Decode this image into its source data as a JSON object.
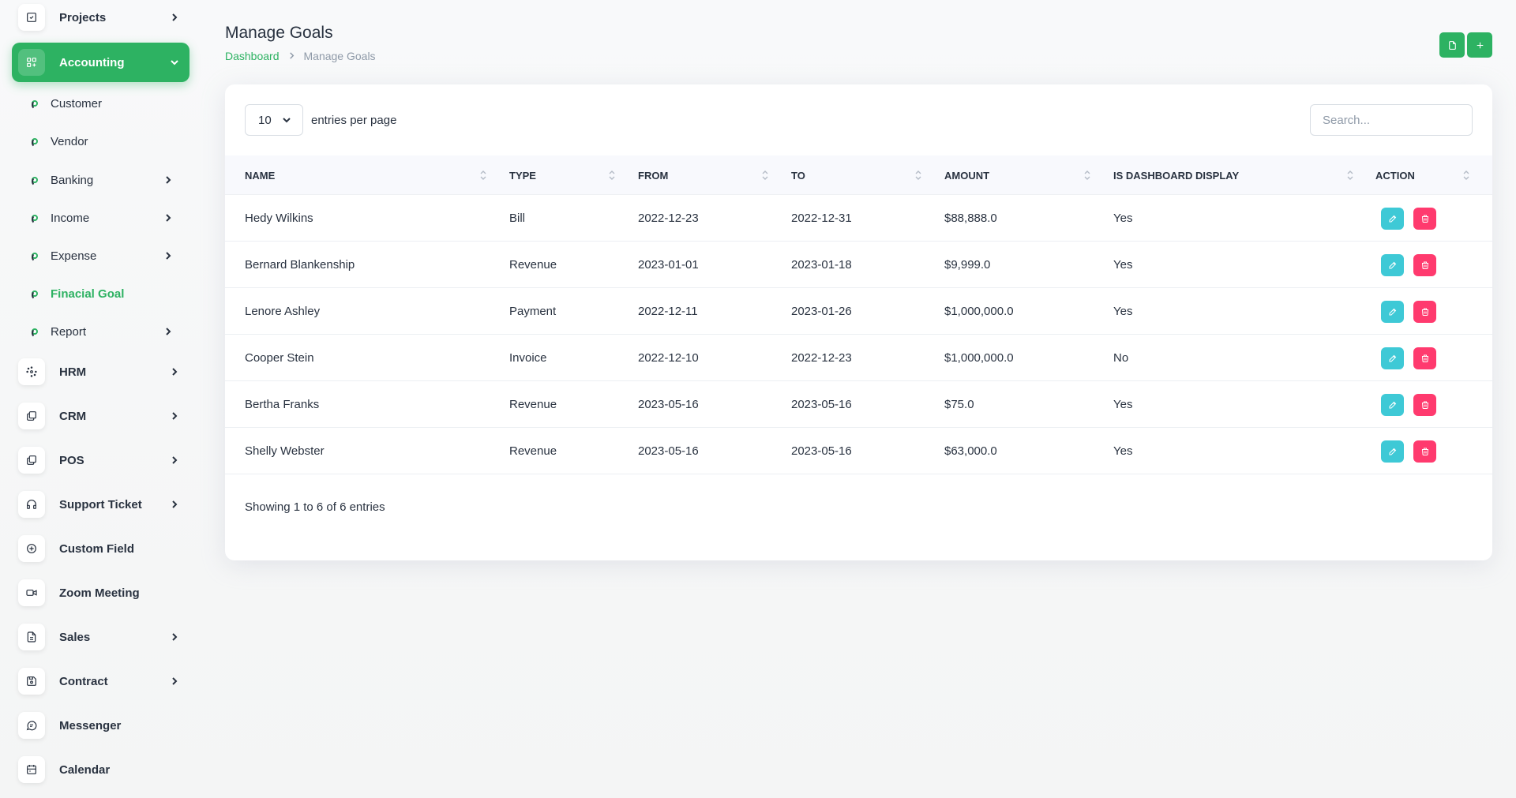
{
  "sidebar": {
    "items": [
      {
        "label": "Projects",
        "icon": "checkbox-icon"
      },
      {
        "label": "Accounting",
        "icon": "grid-icon"
      },
      {
        "label": "HRM",
        "icon": "hrm-icon"
      },
      {
        "label": "CRM",
        "icon": "layers-icon"
      },
      {
        "label": "POS",
        "icon": "layers-icon"
      },
      {
        "label": "Support Ticket",
        "icon": "headphones-icon"
      },
      {
        "label": "Custom Field",
        "icon": "plus-circle-icon"
      },
      {
        "label": "Zoom Meeting",
        "icon": "video-icon"
      },
      {
        "label": "Sales",
        "icon": "file-icon"
      },
      {
        "label": "Contract",
        "icon": "device-floppy-icon"
      },
      {
        "label": "Messenger",
        "icon": "message-icon"
      },
      {
        "label": "Calendar",
        "icon": "calendar-icon"
      }
    ],
    "accounting_sub": [
      {
        "label": "Customer"
      },
      {
        "label": "Vendor"
      },
      {
        "label": "Banking"
      },
      {
        "label": "Income"
      },
      {
        "label": "Expense"
      },
      {
        "label": "Finacial Goal"
      },
      {
        "label": "Report"
      }
    ]
  },
  "header": {
    "title": "Manage Goals",
    "breadcrumb": {
      "link": "Dashboard",
      "current": "Manage Goals"
    }
  },
  "table_controls": {
    "per_page_value": "10",
    "per_page_label": "entries per page",
    "search_placeholder": "Search..."
  },
  "table": {
    "columns": [
      "NAME",
      "TYPE",
      "FROM",
      "TO",
      "AMOUNT",
      "IS DASHBOARD DISPLAY",
      "ACTION"
    ],
    "rows": [
      {
        "name": "Hedy Wilkins",
        "type": "Bill",
        "from": "2022-12-23",
        "to": "2022-12-31",
        "amount": "$88,888.0",
        "display": "Yes"
      },
      {
        "name": "Bernard Blankenship",
        "type": "Revenue",
        "from": "2023-01-01",
        "to": "2023-01-18",
        "amount": "$9,999.0",
        "display": "Yes"
      },
      {
        "name": "Lenore Ashley",
        "type": "Payment",
        "from": "2022-12-11",
        "to": "2023-01-26",
        "amount": "$1,000,000.0",
        "display": "Yes"
      },
      {
        "name": "Cooper Stein",
        "type": "Invoice",
        "from": "2022-12-10",
        "to": "2022-12-23",
        "amount": "$1,000,000.0",
        "display": "No"
      },
      {
        "name": "Bertha Franks",
        "type": "Revenue",
        "from": "2023-05-16",
        "to": "2023-05-16",
        "amount": "$75.0",
        "display": "Yes"
      },
      {
        "name": "Shelly Webster",
        "type": "Revenue",
        "from": "2023-05-16",
        "to": "2023-05-16",
        "amount": "$63,000.0",
        "display": "Yes"
      }
    ]
  },
  "footer": {
    "info": "Showing 1 to 6 of 6 entries"
  },
  "colors": {
    "accent": "#2db262",
    "edit": "#3ec9d6",
    "delete": "#ff3a6e"
  }
}
